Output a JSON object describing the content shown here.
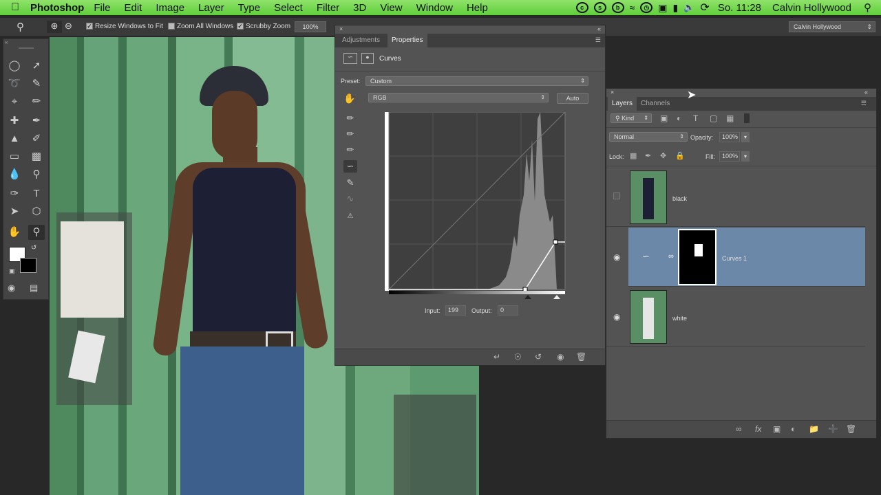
{
  "menubar": {
    "app": "Photoshop",
    "items": [
      "File",
      "Edit",
      "Image",
      "Layer",
      "Type",
      "Select",
      "Filter",
      "3D",
      "View",
      "Window",
      "Help"
    ],
    "clock": "So. 11:28",
    "user": "Calvin Hollywood"
  },
  "options_bar": {
    "resize_windows_label": "Resize Windows to Fit",
    "zoom_all_label": "Zoom All Windows",
    "scrubby_zoom_label": "Scrubby Zoom",
    "zoom_value": "100%",
    "workspace_user": "Calvin Hollywood"
  },
  "properties": {
    "tab_adjustments": "Adjustments",
    "tab_properties": "Properties",
    "panel_title": "Curves",
    "preset_label": "Preset:",
    "preset_value": "Custom",
    "channel_value": "RGB",
    "auto_label": "Auto",
    "input_label": "Input:",
    "input_value": "199",
    "output_label": "Output:",
    "output_value": "0"
  },
  "layers": {
    "tab_layers": "Layers",
    "tab_channels": "Channels",
    "kind_label": "Kind",
    "blend_mode": "Normal",
    "opacity_label": "Opacity:",
    "opacity_value": "100%",
    "lock_label": "Lock:",
    "fill_label": "Fill:",
    "fill_value": "100%",
    "rows": [
      {
        "name": "black",
        "visible": false,
        "selected": false
      },
      {
        "name": "Curves 1",
        "visible": true,
        "selected": true
      },
      {
        "name": "white",
        "visible": true,
        "selected": false
      }
    ]
  },
  "colors": {
    "menubar": "#6fd64a",
    "selected_layer": "#6c88a9",
    "panel_bg": "#535353"
  }
}
